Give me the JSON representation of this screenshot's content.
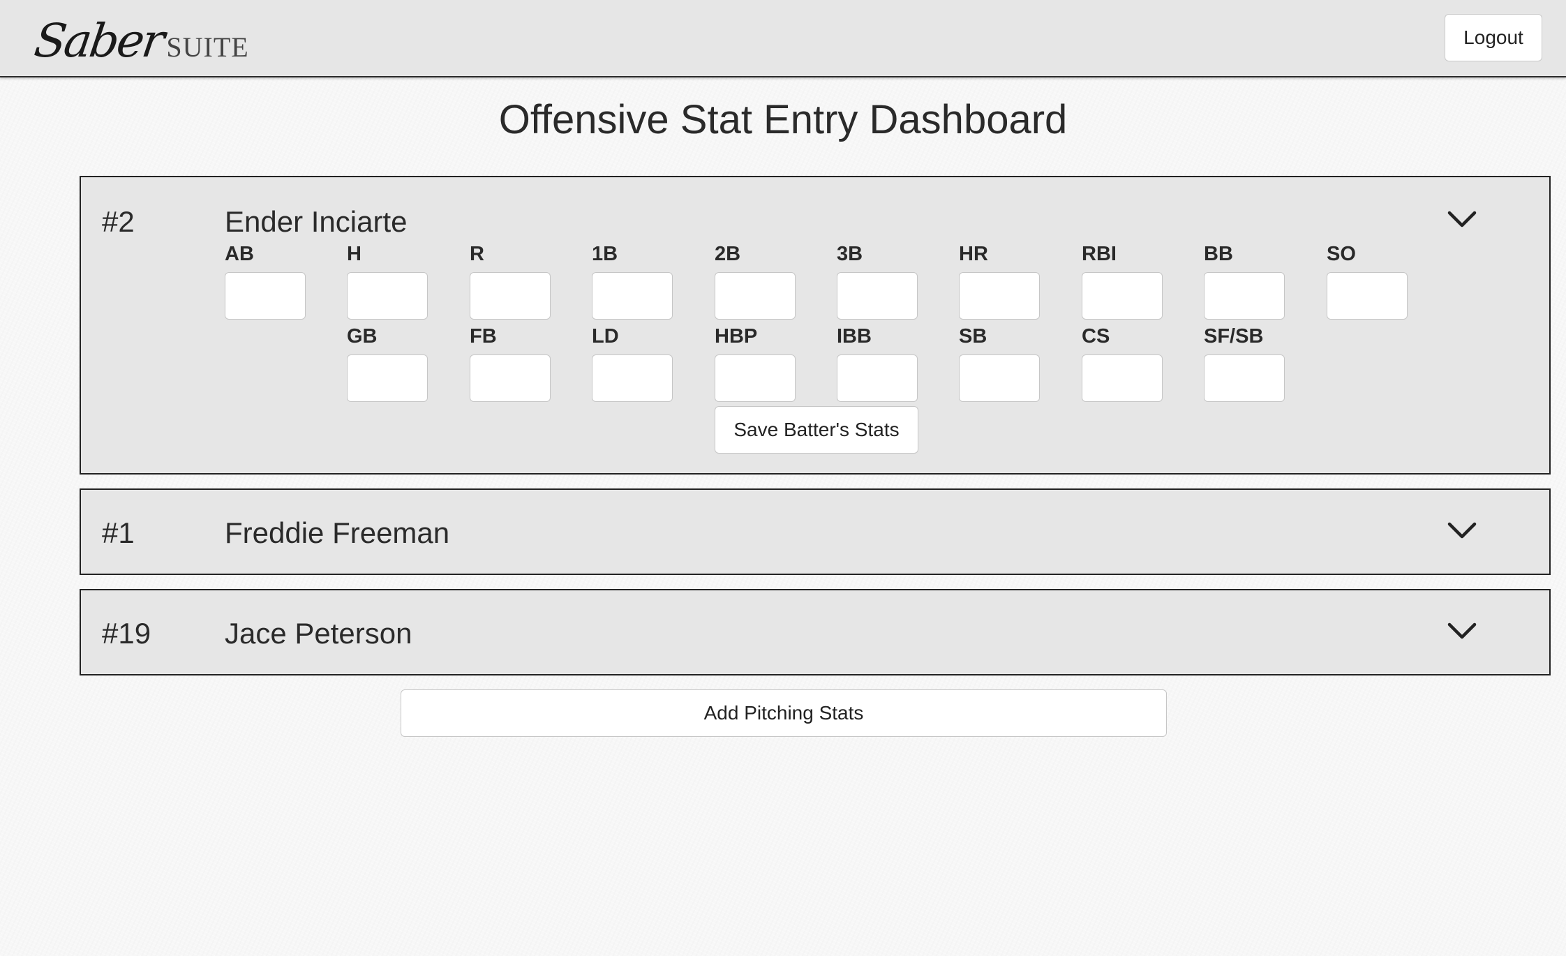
{
  "brand": {
    "script": "Saber",
    "suite": "SUITE"
  },
  "header": {
    "logout_label": "Logout"
  },
  "page": {
    "title": "Offensive Stat Entry Dashboard"
  },
  "players": [
    {
      "number": "#2",
      "name": "Ender Inciarte",
      "expanded": true,
      "stats_row1": [
        {
          "label": "AB",
          "value": ""
        },
        {
          "label": "H",
          "value": ""
        },
        {
          "label": "R",
          "value": ""
        },
        {
          "label": "1B",
          "value": ""
        },
        {
          "label": "2B",
          "value": ""
        },
        {
          "label": "3B",
          "value": ""
        },
        {
          "label": "HR",
          "value": ""
        },
        {
          "label": "RBI",
          "value": ""
        },
        {
          "label": "BB",
          "value": ""
        },
        {
          "label": "SO",
          "value": ""
        }
      ],
      "stats_row2": [
        {
          "label": "GB",
          "value": ""
        },
        {
          "label": "FB",
          "value": ""
        },
        {
          "label": "LD",
          "value": ""
        },
        {
          "label": "HBP",
          "value": ""
        },
        {
          "label": "IBB",
          "value": ""
        },
        {
          "label": "SB",
          "value": ""
        },
        {
          "label": "CS",
          "value": ""
        },
        {
          "label": "SF/SB",
          "value": ""
        }
      ],
      "save_label": "Save Batter's Stats",
      "toggle_icon": "chevron-down-icon"
    },
    {
      "number": "#1",
      "name": "Freddie Freeman",
      "expanded": false,
      "toggle_icon": "chevron-down-icon"
    },
    {
      "number": "#19",
      "name": "Jace Peterson",
      "expanded": false,
      "toggle_icon": "chevron-down-icon"
    }
  ],
  "actions": {
    "add_pitching_label": "Add Pitching Stats"
  }
}
